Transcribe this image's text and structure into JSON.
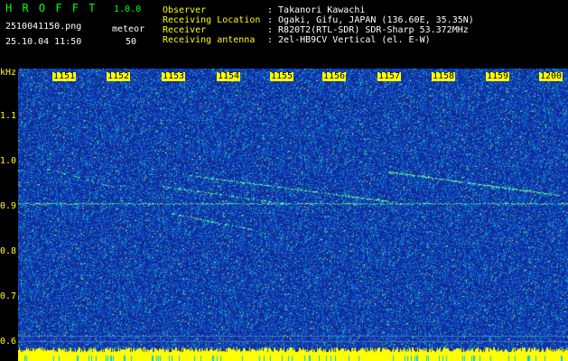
{
  "app": {
    "title": "H R O F F T",
    "version": "1.0.0",
    "filename": "2510041150.png",
    "datetime": "25.10.04 11:50",
    "mode_label": "meteor",
    "count": "50"
  },
  "info": [
    {
      "label": "Observer",
      "value": ": Takanori Kawachi"
    },
    {
      "label": "Receiving Location",
      "value": ": Ogaki, Gifu, JAPAN (136.60E, 35.35N)"
    },
    {
      "label": "Receiver",
      "value": ": R820T2(RTL-SDR) SDR-Sharp 53.372MHz"
    },
    {
      "label": "Receiving antenna",
      "value": ": 2el-HB9CV Vertical (el. E-W)"
    }
  ],
  "y_axis": {
    "unit": "kHz",
    "ticks": [
      "1.1",
      "1.0",
      "0.9",
      "0.8",
      "0.7",
      "0.6"
    ]
  },
  "x_axis": {
    "ticks": [
      "1151",
      "1152",
      "1153",
      "1154",
      "1155",
      "1156",
      "1157",
      "1158",
      "1159",
      "1200"
    ]
  },
  "colors": {
    "background": "#1a3aa8",
    "label_green": "#00ff00",
    "label_white": "#ffffff",
    "label_yellow": "#ffff00"
  }
}
